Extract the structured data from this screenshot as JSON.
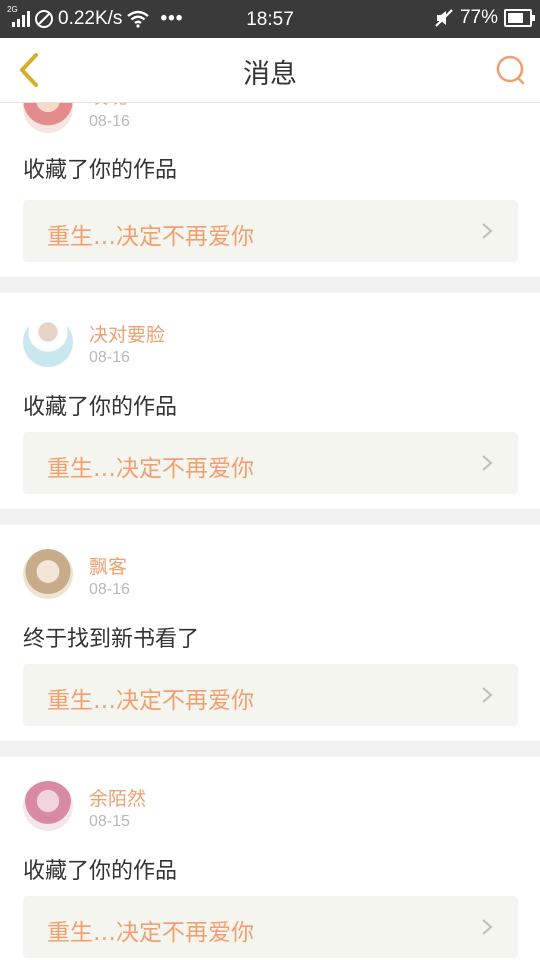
{
  "status_bar": {
    "network_type": "2G",
    "speed": "0.22K/s",
    "more": "•••",
    "time": "18:57",
    "battery": "77%",
    "battery_level": 0.77
  },
  "header": {
    "title": "消息"
  },
  "colors": {
    "accent": "#f0a070",
    "header_icon": "#d8ad2e"
  },
  "messages": [
    {
      "user": "玫瑰",
      "date": "08-16",
      "text": "收藏了你的作品",
      "work": "重生…决定不再爱你"
    },
    {
      "user": "决对要脸",
      "date": "08-16",
      "text": "收藏了你的作品",
      "work": "重生…决定不再爱你"
    },
    {
      "user": "飘客",
      "date": "08-16",
      "text": "终于找到新书看了",
      "work": "重生…决定不再爱你"
    },
    {
      "user": "余陌然",
      "date": "08-15",
      "text": "收藏了你的作品",
      "work": "重生…决定不再爱你"
    }
  ]
}
